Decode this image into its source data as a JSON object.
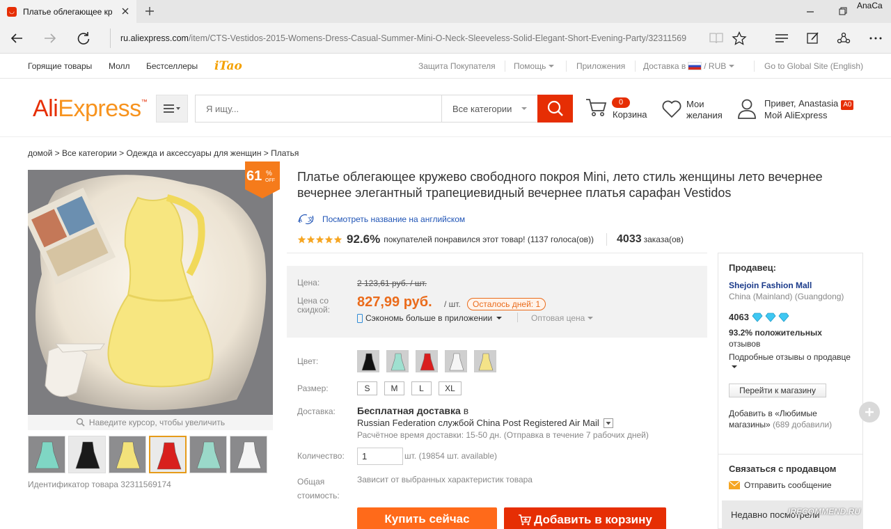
{
  "browser": {
    "tab_title": "Платье облегающее кр",
    "user_name": "AnaCa",
    "url_domain": "ru.aliexpress.com",
    "url_path": "/item/CTS-Vestidos-2015-Womens-Dress-Casual-Summer-Mini-O-Neck-Sleeveless-Solid-Elegant-Short-Evening-Party/32311569"
  },
  "topnav": {
    "left": [
      "Горящие товары",
      "Молл",
      "Бестселлеры"
    ],
    "itao": "iTao",
    "buyer_protection": "Защита Покупателя",
    "help": "Помощь",
    "apps": "Приложения",
    "delivery_to": "Доставка в",
    "currency": "RUB",
    "global_site": "Go to Global Site (English)"
  },
  "header": {
    "logo_ali": "Ali",
    "logo_express": "Express",
    "logo_tm": "™",
    "search_placeholder": "Я ищу...",
    "search_category": "Все категории",
    "cart_count": "0",
    "cart_label": "Корзина",
    "wishlist_line1": "Мои",
    "wishlist_line2": "желания",
    "greeting": "Привет, Anastasia",
    "badge": "A0",
    "my_aliexpress": "Мой AliExpress"
  },
  "breadcrumb": "домой > Все категории > Одежда и аксессуары для женщин > Платья",
  "gallery": {
    "discount_value": "61",
    "discount_pct": "%",
    "discount_off": "OFF",
    "zoom_hint": "Наведите курсор, чтобы увеличить",
    "product_id": "Идентификатор товара 32311569174",
    "thumb_colors": [
      "#7fd6c4",
      "#1a1a1a",
      "#f3e27a",
      "#d8201d",
      "#9ad9c9",
      "#f4f4f4"
    ],
    "main_dress_color": "#f7e680"
  },
  "product": {
    "title": "Платье облегающее кружево свободного покроя Mini, лето стиль женщины лето вечернее вечернее элегантный трапециевидный вечернее платья сарафан Vestidos",
    "translate_link": "Посмотреть название на английском",
    "rating_pct": "92.6%",
    "rating_text": "покупателей понравился этот товар! (1137 голоса(ов))",
    "orders": "4033",
    "orders_label": "заказа(ов)",
    "stars": 5
  },
  "price": {
    "label_price": "Цена:",
    "label_discount_1": "Цена со",
    "label_discount_2": "скидкой:",
    "old_price": "2 123,61 руб. / шт.",
    "new_price": "827,99 руб.",
    "per_unit": "/ шт.",
    "days_left": "Осталось дней: 1",
    "app_save": "Сэкономь больше в приложении",
    "wholesale": "Оптовая цена"
  },
  "options": {
    "color_label": "Цвет:",
    "colors": [
      "#111111",
      "#9fe0d0",
      "#d91e1e",
      "#f5f5f5",
      "#f4e388"
    ],
    "size_label": "Размер:",
    "sizes": [
      "S",
      "M",
      "L",
      "XL"
    ],
    "delivery_label": "Доставка:",
    "delivery_free": "Бесплатная доставка",
    "delivery_in": "в",
    "delivery_service": "Russian Federation службой China Post Registered Air Mail",
    "delivery_time": "Расчётное время доставки: 15-50 дн. (Отправка в течение 7 рабочих дней)",
    "qty_label": "Количество:",
    "qty_value": "1",
    "qty_hint": "шт. (19854 шт. available)",
    "total_label_1": "Общая",
    "total_label_2": "стоимость:",
    "total_note": "Зависит от выбранных характеристик товара",
    "buy_now": "Купить сейчас",
    "add_to_cart": "Добавить в корзину"
  },
  "seller": {
    "title": "Продавец:",
    "store_name": "Shejoin Fashion Mall",
    "location": "China (Mainland) (Guangdong)",
    "score": "4063",
    "positive": "93.2% положительных",
    "positive_2": "отзывов",
    "detailed": "Подробные отзывы о продавце",
    "goto_store": "Перейти к магазину",
    "fav_1": "Добавить в «Любимые",
    "fav_2a": "магазины»",
    "fav_2b": "(689 добавили)",
    "contact_title": "Связаться с продавцом",
    "send_message": "Отправить сообщение",
    "recently": "Недавно посмотрели"
  },
  "watermark": "IRECOMMEND.RU",
  "colors": {
    "brand_red": "#e62e04",
    "brand_orange": "#f7931e",
    "price_orange": "#ea6b1b",
    "link_blue": "#2155b6"
  }
}
